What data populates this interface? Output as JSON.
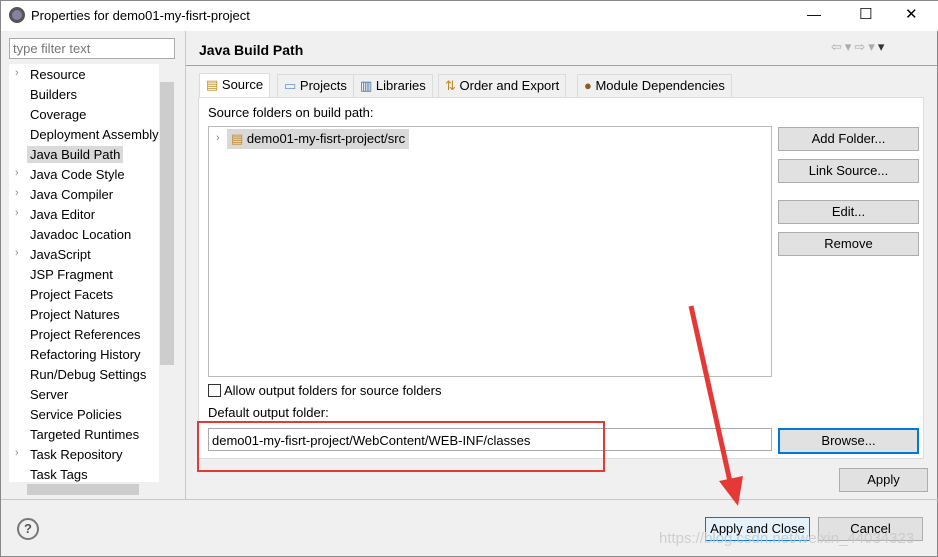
{
  "window": {
    "title": "Properties for demo01-my-fisrt-project",
    "minimize": "—",
    "maximize": "☐",
    "close": "✕"
  },
  "filter": {
    "placeholder": "type filter text"
  },
  "tree": [
    {
      "label": "Resource",
      "expandable": true
    },
    {
      "label": "Builders"
    },
    {
      "label": "Coverage"
    },
    {
      "label": "Deployment Assembly"
    },
    {
      "label": "Java Build Path",
      "selected": true
    },
    {
      "label": "Java Code Style",
      "expandable": true
    },
    {
      "label": "Java Compiler",
      "expandable": true
    },
    {
      "label": "Java Editor",
      "expandable": true
    },
    {
      "label": "Javadoc Location"
    },
    {
      "label": "JavaScript",
      "expandable": true
    },
    {
      "label": "JSP Fragment"
    },
    {
      "label": "Project Facets"
    },
    {
      "label": "Project Natures"
    },
    {
      "label": "Project References"
    },
    {
      "label": "Refactoring History"
    },
    {
      "label": "Run/Debug Settings"
    },
    {
      "label": "Server"
    },
    {
      "label": "Service Policies"
    },
    {
      "label": "Targeted Runtimes"
    },
    {
      "label": "Task Repository",
      "expandable": true
    },
    {
      "label": "Task Tags"
    }
  ],
  "page": {
    "title": "Java Build Path"
  },
  "tabs": [
    {
      "label": "Source"
    },
    {
      "label": "Projects"
    },
    {
      "label": "Libraries"
    },
    {
      "label": "Order and Export"
    },
    {
      "label": "Module Dependencies"
    }
  ],
  "source": {
    "folders_label": "Source folders on build path:",
    "folders": [
      "demo01-my-fisrt-project/src"
    ],
    "buttons": {
      "add_folder": "Add Folder...",
      "link_source": "Link Source...",
      "edit": "Edit...",
      "remove": "Remove",
      "browse": "Browse..."
    },
    "allow_output_label": "Allow output folders for source folders",
    "allow_output_checked": false,
    "default_output_label": "Default output folder:",
    "default_output_value": "demo01-my-fisrt-project/WebContent/WEB-INF/classes"
  },
  "footer": {
    "apply": "Apply",
    "apply_close": "Apply and Close",
    "cancel": "Cancel",
    "help": "?"
  },
  "watermark": "https://blog.csdn.net/weixin_44034323",
  "colors": {
    "annotation": "#e53935",
    "focus": "#0078d7"
  }
}
